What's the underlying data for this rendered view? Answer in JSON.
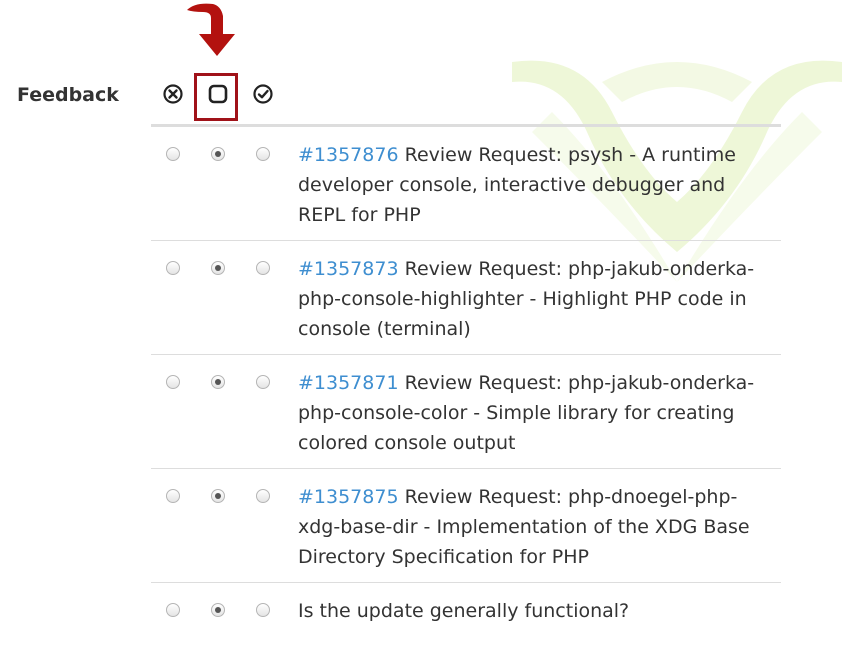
{
  "feedback": {
    "label": "Feedback"
  },
  "header_icons": {
    "reject": "circle-x-icon",
    "untested": "square-icon",
    "works": "circle-check-icon"
  },
  "colors": {
    "link": "#3e8ed0",
    "highlight": "#a01219",
    "text": "#333333",
    "divider": "#dddddd"
  },
  "rows": [
    {
      "bug_id": "#1357876",
      "text": "Review Request: psysh - A runtime developer console, interactive debugger and REPL for PHP",
      "selected": "untested"
    },
    {
      "bug_id": "#1357873",
      "text": "Review Request: php-jakub-onderka-php-console-highlighter - Highlight PHP code in console (terminal)",
      "selected": "untested"
    },
    {
      "bug_id": "#1357871",
      "text": "Review Request: php-jakub-onderka-php-console-color - Simple library for creating colored console output",
      "selected": "untested"
    },
    {
      "bug_id": "#1357875",
      "text": "Review Request: php-dnoegel-php-xdg-base-dir - Implementation of the XDG Base Directory Specification for PHP",
      "selected": "untested"
    },
    {
      "bug_id": "",
      "text": "Is the update generally functional?",
      "selected": "untested"
    }
  ]
}
